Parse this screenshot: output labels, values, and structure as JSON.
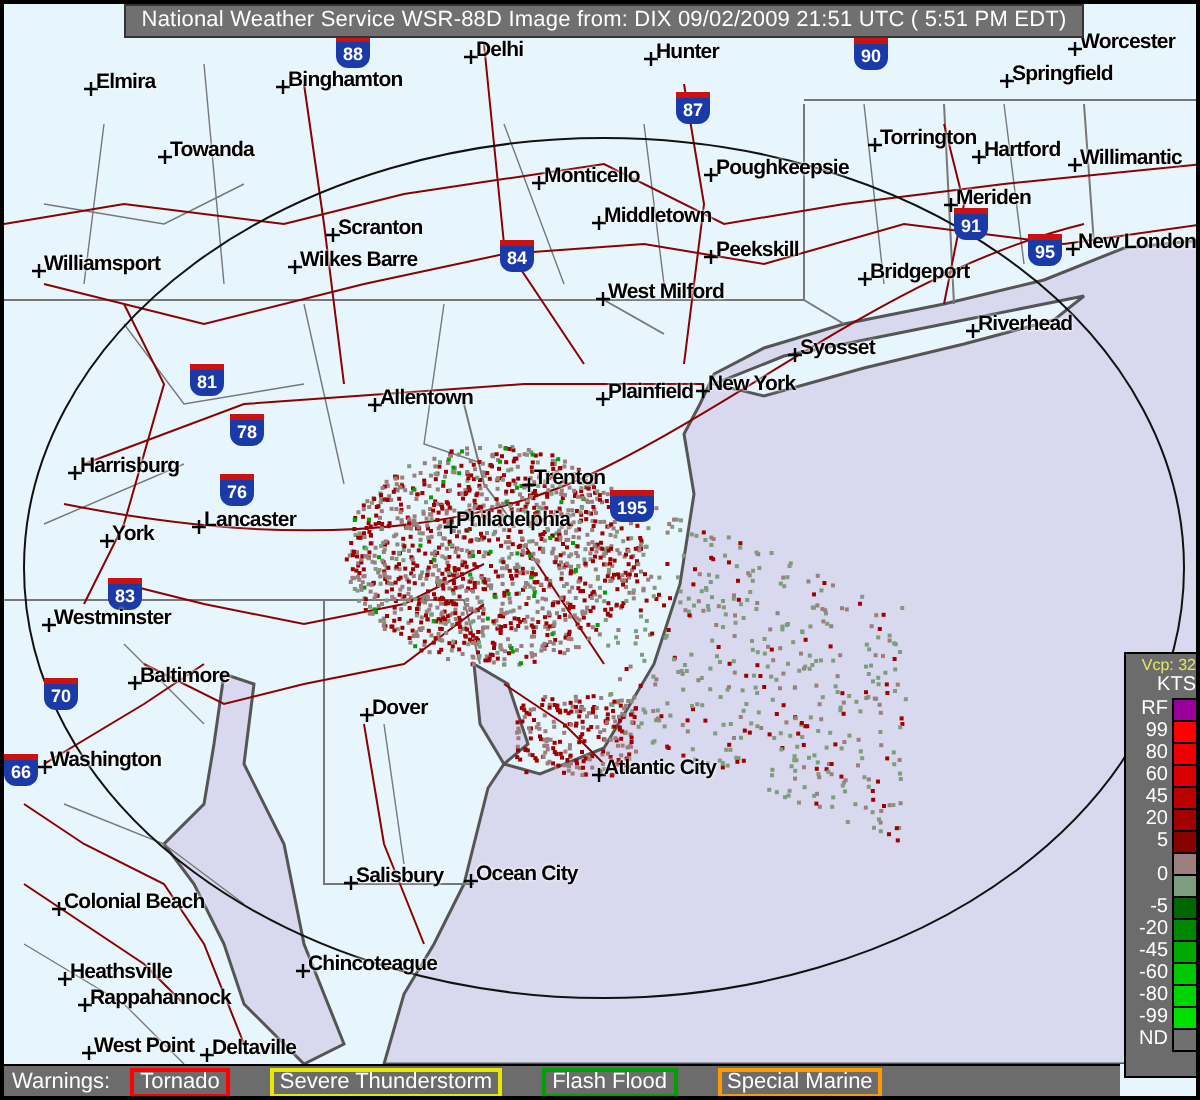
{
  "title_bar": {
    "text": "National Weather Service WSR-88D Image from: DIX 09/02/2009 21:51 UTC ( 5:51 PM EDT)"
  },
  "map": {
    "cities": [
      {
        "name": "Delhi"
      },
      {
        "name": "Hunter"
      },
      {
        "name": "Worcester"
      },
      {
        "name": "Elmira"
      },
      {
        "name": "Binghamton"
      },
      {
        "name": "Springfield"
      },
      {
        "name": "Towanda"
      },
      {
        "name": "Torrington"
      },
      {
        "name": "Monticello"
      },
      {
        "name": "Hartford"
      },
      {
        "name": "Poughkeepsie"
      },
      {
        "name": "Willimantic"
      },
      {
        "name": "Meriden"
      },
      {
        "name": "Middletown"
      },
      {
        "name": "Scranton"
      },
      {
        "name": "New London"
      },
      {
        "name": "Peekskill"
      },
      {
        "name": "Williamsport"
      },
      {
        "name": "Wilkes Barre"
      },
      {
        "name": "Bridgeport"
      },
      {
        "name": "West Milford"
      },
      {
        "name": "Riverhead"
      },
      {
        "name": "Syosset"
      },
      {
        "name": "New York"
      },
      {
        "name": "Allentown"
      },
      {
        "name": "Plainfield"
      },
      {
        "name": "Harrisburg"
      },
      {
        "name": "Trenton"
      },
      {
        "name": "Lancaster"
      },
      {
        "name": "Philadelphia"
      },
      {
        "name": "York"
      },
      {
        "name": "Westminster"
      },
      {
        "name": "Baltimore"
      },
      {
        "name": "Atlantic City"
      },
      {
        "name": "Dover"
      },
      {
        "name": "Washington"
      },
      {
        "name": "Salisbury"
      },
      {
        "name": "Ocean City"
      },
      {
        "name": "Colonial Beach"
      },
      {
        "name": "Heathsville"
      },
      {
        "name": "Chincoteague"
      },
      {
        "name": "Rappahannock"
      },
      {
        "name": "West Point"
      },
      {
        "name": "Deltaville"
      }
    ],
    "highways": [
      {
        "number": "88"
      },
      {
        "number": "90"
      },
      {
        "number": "87"
      },
      {
        "number": "91"
      },
      {
        "number": "84"
      },
      {
        "number": "95"
      },
      {
        "number": "81"
      },
      {
        "number": "78"
      },
      {
        "number": "76"
      },
      {
        "number": "195"
      },
      {
        "number": "83"
      },
      {
        "number": "70"
      },
      {
        "number": "66"
      }
    ]
  },
  "legend": {
    "vcp": "Vcp: 32",
    "units": "KTS",
    "values": [
      "RF",
      "99",
      "80",
      "60",
      "45",
      "20",
      "5",
      "0",
      "-5",
      "-20",
      "-45",
      "-60",
      "-80",
      "-99",
      "ND"
    ],
    "swatches": [
      {
        "color": "#990099"
      },
      {
        "color": "#ff0000"
      },
      {
        "color": "#ee0000"
      },
      {
        "color": "#d80000"
      },
      {
        "color": "#bb0000"
      },
      {
        "color": "#a00000"
      },
      {
        "color": "#880000"
      },
      {
        "color": "#9c7e7e"
      },
      {
        "color": "#7e9c7e"
      },
      {
        "color": "#006600"
      },
      {
        "color": "#008800"
      },
      {
        "color": "#00a800"
      },
      {
        "color": "#00c800"
      },
      {
        "color": "#00d400"
      },
      {
        "color": "#00e000"
      },
      {
        "color": "#707070"
      }
    ]
  },
  "warnings": {
    "label": "Warnings:",
    "items": [
      {
        "label": "Tornado",
        "color": "#ff0000"
      },
      {
        "label": "Severe Thunderstorm",
        "color": "#e8e800"
      },
      {
        "label": "Flash Flood",
        "color": "#00a000"
      },
      {
        "label": "Special Marine",
        "color": "#ff9900"
      }
    ]
  }
}
